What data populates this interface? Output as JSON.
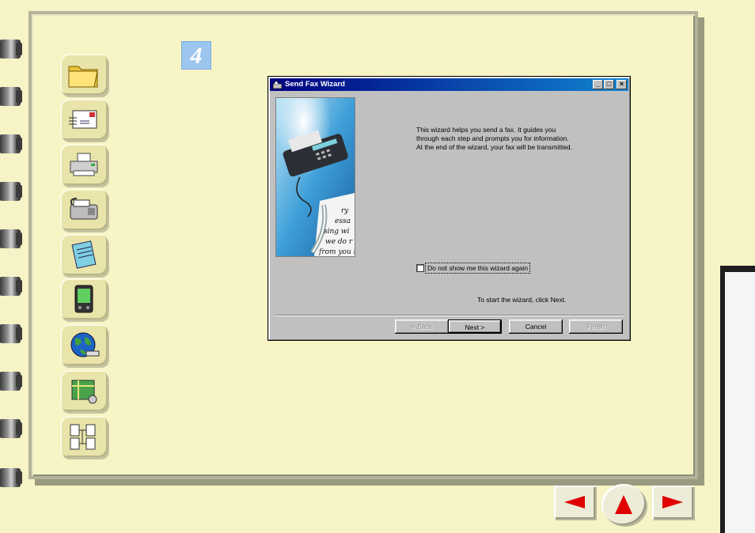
{
  "step": {
    "number": "4"
  },
  "nav": {
    "items": [
      {
        "name": "folder-icon"
      },
      {
        "name": "mail-icon"
      },
      {
        "name": "printer-icon"
      },
      {
        "name": "fax-icon"
      },
      {
        "name": "notepad-icon"
      },
      {
        "name": "pda-icon"
      },
      {
        "name": "globe-icon"
      },
      {
        "name": "map-icon"
      },
      {
        "name": "network-documents-icon"
      }
    ]
  },
  "dialog": {
    "title": "Send Fax Wizard",
    "intro": "This wizard helps you send a fax. It guides you\nthrough each step and prompts you for information.\nAt the end of the wizard, your fax will be transmitted.",
    "checkbox_label": "Do not show me this wizard again",
    "checkbox_checked": false,
    "start_hint": "To start the wizard, click Next.",
    "buttons": {
      "back": "< Back",
      "next": "Next >",
      "cancel": "Cancel",
      "finish": "Finish"
    },
    "art_handwriting": [
      "ry",
      "essa",
      "sing wi",
      "we do r",
      "from you s"
    ]
  },
  "colors": {
    "page_bg": "#f6f3c6",
    "titlebar": "#000080",
    "step_badge": "#9dc6ef",
    "nav_arrow": "#e00000"
  }
}
